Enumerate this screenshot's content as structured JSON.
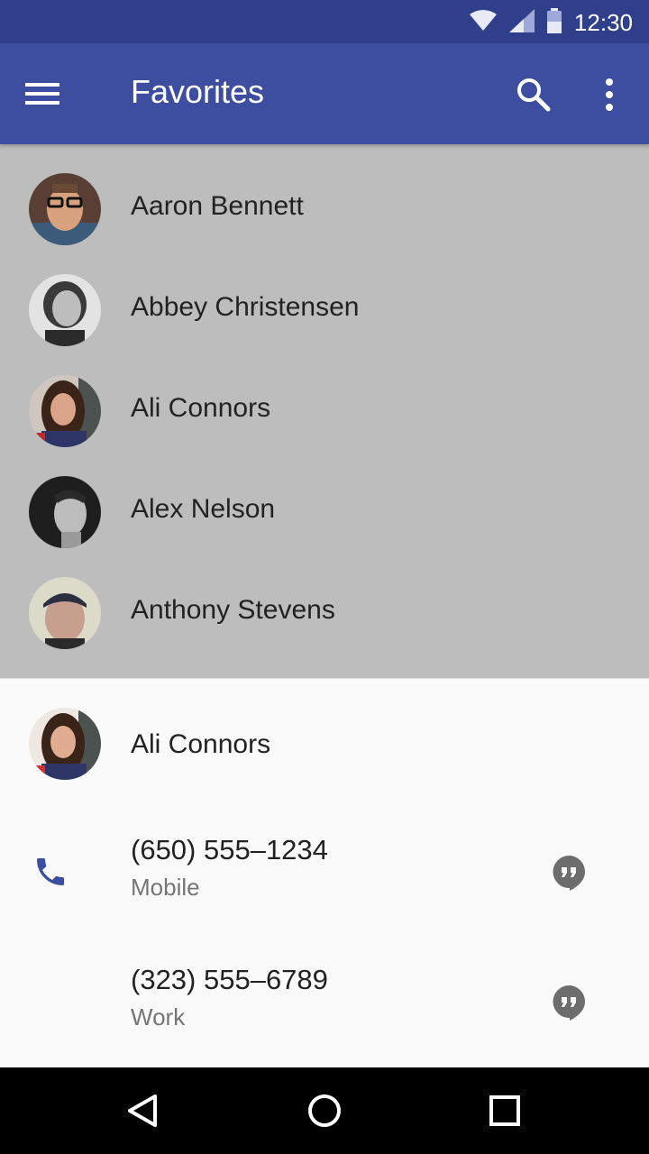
{
  "status_bar": {
    "time": "12:30",
    "icons": [
      "wifi-icon",
      "signal-icon",
      "battery-icon"
    ]
  },
  "app_bar": {
    "title": "Favorites",
    "icons": [
      "menu-icon",
      "search-icon",
      "more-vert-icon"
    ],
    "color": "#3d4ea0"
  },
  "favorites": [
    {
      "name": "Aaron Bennett"
    },
    {
      "name": "Abbey Christensen"
    },
    {
      "name": "Ali Connors"
    },
    {
      "name": "Alex Nelson"
    },
    {
      "name": "Anthony Stevens"
    }
  ],
  "sheet": {
    "contact_name": "Ali Connors",
    "phones": [
      {
        "number": "(650) 555–1234",
        "type": "Mobile"
      },
      {
        "number": "(323) 555–6789",
        "type": "Work"
      }
    ]
  },
  "nav_bar": {
    "icons": [
      "back-icon",
      "home-icon",
      "recents-icon"
    ]
  }
}
